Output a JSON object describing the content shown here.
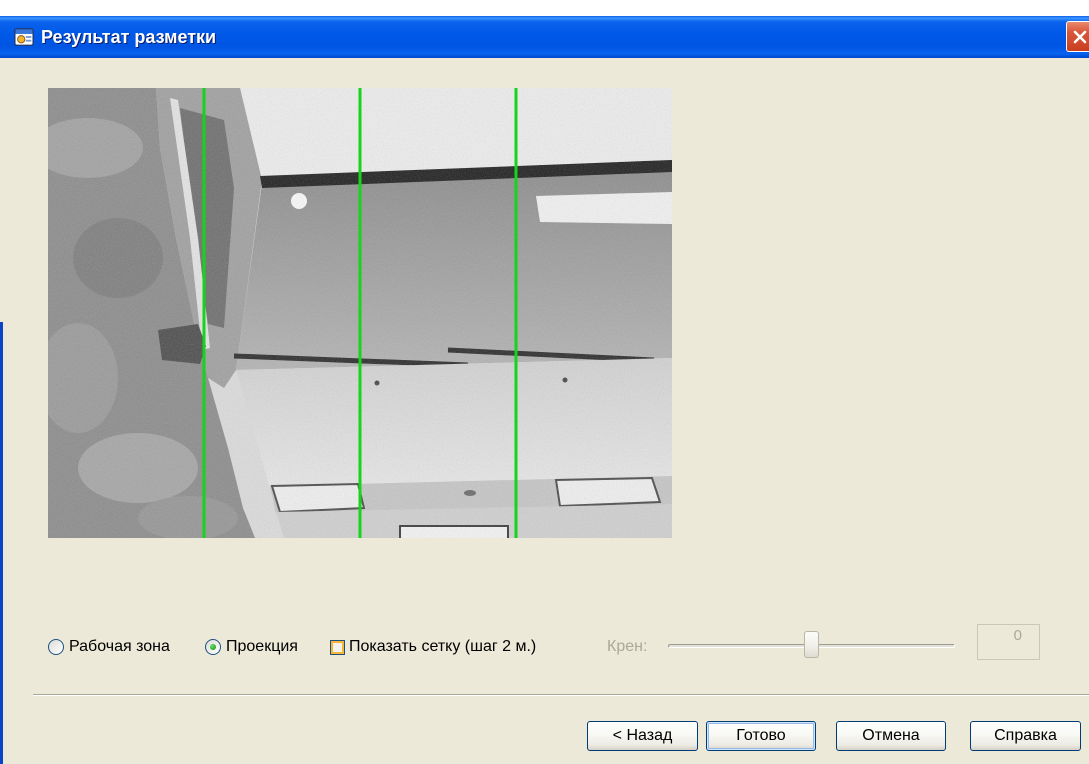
{
  "window": {
    "title": "Результат разметки",
    "title_icon": "dialog-icon",
    "close_icon": "close-icon"
  },
  "mode": {
    "work_zone": {
      "label": "Рабочая зона",
      "checked": false
    },
    "projection": {
      "label": "Проекция",
      "checked": true
    }
  },
  "show_grid": {
    "label": "Показать сетку (шаг 2 м.)",
    "checked": false
  },
  "roll": {
    "label": "Крен:",
    "value": "0",
    "slider_level": 0.5,
    "enabled": false
  },
  "buttons": {
    "back": "< Назад",
    "done": "Готово",
    "cancel": "Отмена",
    "help": "Справка"
  },
  "colors": {
    "title_bar": "#0058E8",
    "dialog_background": "#ECE9D8",
    "grid_line": "#17D417",
    "radio_dot": "#21A121",
    "checkbox_hover": "#F8B636",
    "disabled_text": "#ACA899",
    "button_border": "#003C74"
  }
}
